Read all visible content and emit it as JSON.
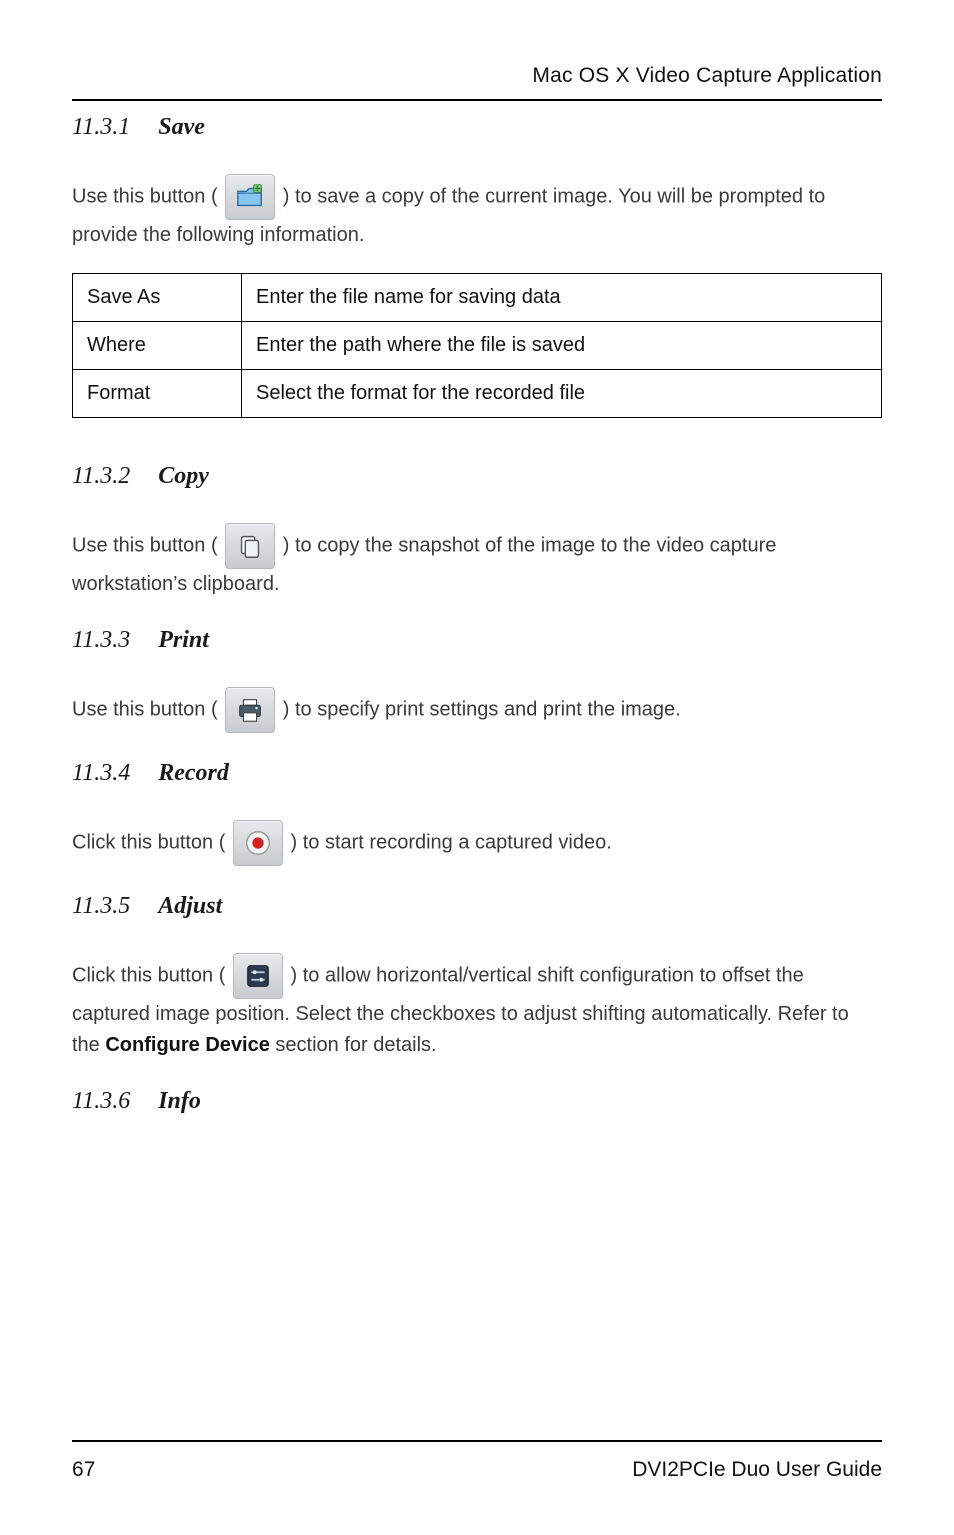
{
  "running_head": "Mac OS X Video Capture Application",
  "sections": {
    "save": {
      "num": "11.3.1",
      "title": "Save",
      "icon": "folder-save-icon",
      "line_before": "Use this button (",
      "line_after": ") to save a copy of the current image.  You will be prompted to provide the following information.",
      "table": [
        {
          "key": "Save As",
          "val": "Enter the file name for saving data"
        },
        {
          "key": "Where",
          "val": "Enter the path where the file is saved"
        },
        {
          "key": "Format",
          "val": "Select the format for the recorded file"
        }
      ]
    },
    "copy": {
      "num": "11.3.2",
      "title": "Copy",
      "icon": "clipboard-icon",
      "line_before": "Use this button (",
      "line_after": " ) to copy the snapshot of the image to the video capture workstation’s clipboard."
    },
    "print": {
      "num": "11.3.3",
      "title": "Print",
      "icon": "printer-icon",
      "line_before": "Use this button (",
      "line_after": " ) to specify print settings and print the image."
    },
    "record": {
      "num": "11.3.4",
      "title": "Record",
      "icon": "record-icon",
      "line_before": "Click this button (",
      "line_after": " ) to start recording a captured video."
    },
    "adjust": {
      "num": "11.3.5",
      "title": "Adjust",
      "icon": "sliders-icon",
      "line_before": "Click this button (",
      "line_mid": " ) to allow horizontal/vertical shift configuration to offset the captured image position. Select the checkboxes to adjust shifting automatically. Refer to the ",
      "bold": "Configure Device",
      "line_after": " section for details."
    },
    "info": {
      "num": "11.3.6",
      "title": "Info"
    }
  },
  "footer": {
    "page": "67",
    "title": "DVI2PCIe Duo User Guide"
  }
}
